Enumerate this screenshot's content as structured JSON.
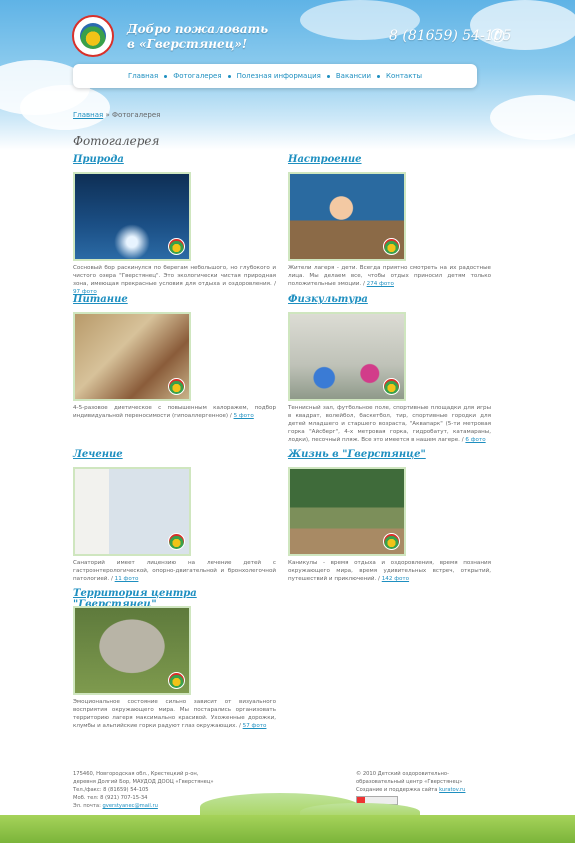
{
  "header": {
    "welcome_line1": "Добро пожаловать",
    "welcome_line2": "в «Гверстянец»!",
    "phone": "8 (81659) 54-105",
    "phone_icon": "phone-icon"
  },
  "nav": {
    "items": [
      {
        "label": "Главная"
      },
      {
        "label": "Фотогалерея"
      },
      {
        "label": "Полезная информация"
      },
      {
        "label": "Вакансии"
      },
      {
        "label": "Контакты"
      }
    ]
  },
  "breadcrumb": {
    "home": "Главная",
    "separator": "»",
    "current": "Фотогалерея"
  },
  "page_title": "Фотогалерея",
  "galleries": [
    {
      "title": "Природа",
      "description": "Сосновый бор раскинулся по берегам небольшого, но глубокого и чистого озера \"Гверстянец\". Это экологически чистая природная зона, имеющая прекрасные условия для отдыха и оздоровления. /",
      "count": "97 фото",
      "image": "lake-water"
    },
    {
      "title": "Настроение",
      "description": "Жители лагеря - дети. Всегда приятно смотреть на их радостные лица. Мы делаем все, чтобы отдых приносил детям только положительные эмоции. /",
      "count": "274 фото",
      "image": "boy-on-pier"
    },
    {
      "title": "Питание",
      "description": "4-5-разовое диетическое с повышенным калоражем, подбор индивидуальной переносимости (гипоаллергенное) /",
      "count": "5 фото",
      "image": "dining-hall"
    },
    {
      "title": "Физкультура",
      "description": "Теннисный зал, футбольное поле, спортивные площадки для игры в квадрат, волейбол, баскетбол, тир, спортивные городки для детей младшего и старшего возраста, \"Аквапарк\" (5-ти метровая горка \"Айсберг\", 4-х метровая горка, гидробатут, катамараны, лодки), песочный пляж. Все это имеется в нашем лагере. /",
      "count": "6 фото",
      "image": "gym"
    },
    {
      "title": "Лечение",
      "description": "Санаторий имеет лицензию на лечение детей с гастроэнтерологической, опорно-двигательной и бронхолегочной патологией. /",
      "count": "11 фото",
      "image": "treatment-room"
    },
    {
      "title": "Жизнь в \"Гверстянце\"",
      "description": "Каникулы - время отдыха и оздоровления, время познания окружающего мира, время удивительных встреч, открытий, путешествий и приключений. /",
      "count": "142 фото",
      "image": "camp-life"
    },
    {
      "title": "Территория центра \"Гверстянец\"",
      "description": "Эмоциональное состояние сильно зависит от визуального восприятия окружающего мира. Мы постарались организовать территорию лагеря максимально красивой. Ухоженные дорожки, клумбы и альпийские горки радуют глаз окружающих. /",
      "count": "57 фото",
      "image": "stone-face"
    }
  ],
  "footer": {
    "address1": "175460, Новгородская обл., Крестецкий р-он,",
    "address2": "деревня Долгий Бор, МАУДОД ДООЦ «Гверстянец»",
    "tel": "Тел./факс: 8 (81659) 54-105",
    "mob": "Моб. тел: 8 (921) 707-15-34",
    "email_label": "Эл. почта:",
    "email": "gverstyanec@mail.ru",
    "copyright": "© 2010 Детский оздоровительно-образовательный центр «Гверстянец»",
    "support_label": "Создание и поддержка сайта",
    "support_link": "kuratov.ru"
  }
}
